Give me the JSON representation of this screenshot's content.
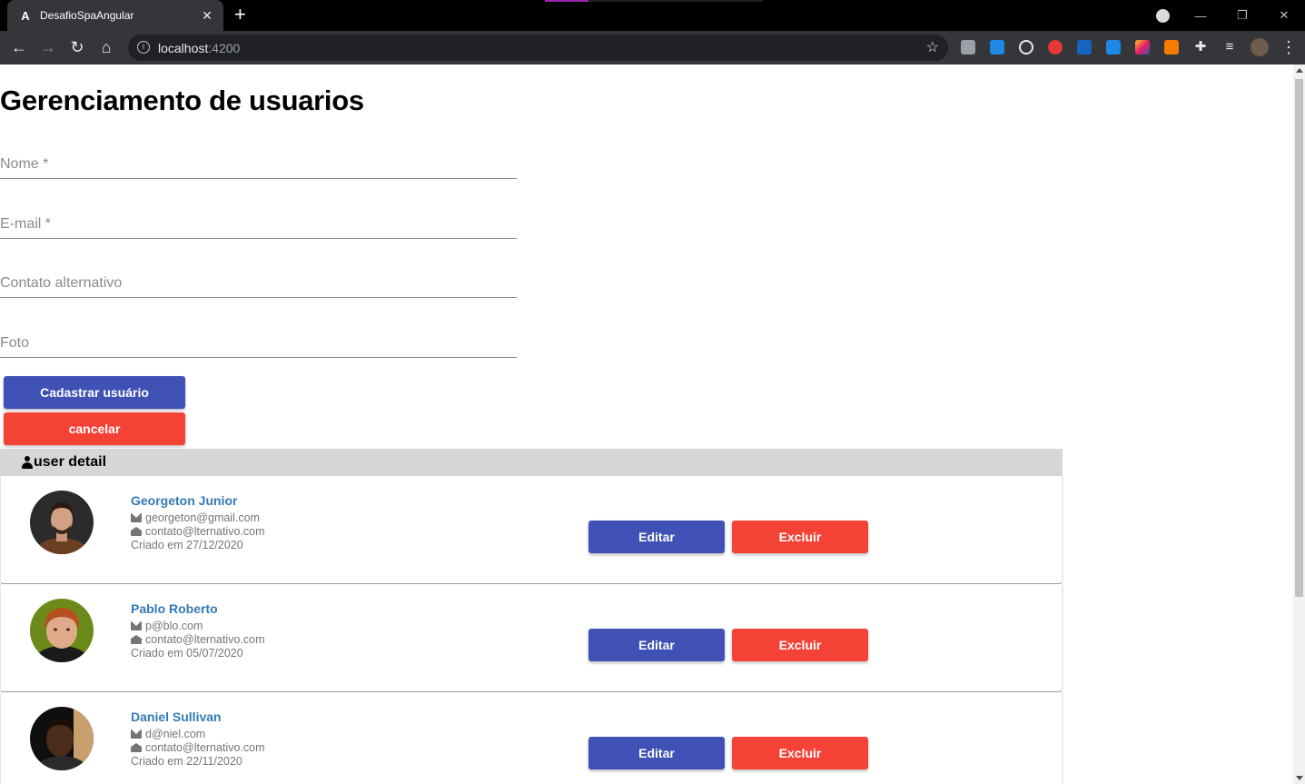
{
  "browser": {
    "tab_title": "DesafioSpaAngular",
    "tab_favicon": "A",
    "url_host": "localhost",
    "url_port": ":4200",
    "colors": {
      "tabbar": "#000000",
      "toolbar": "#35363a",
      "progress": "#9c27b0"
    }
  },
  "page": {
    "title": "Gerenciamento de usuarios",
    "form": {
      "name_placeholder": "Nome *",
      "email_placeholder": "E-mail *",
      "alt_contact_placeholder": "Contato alternativo",
      "photo_placeholder": "Foto",
      "submit_label": "Cadastrar usuário",
      "cancel_label": "cancelar"
    },
    "list": {
      "header": "user detail",
      "users": [
        {
          "name": "Georgeton Junior",
          "email": "georgeton@gmail.com",
          "alt_contact": "contato@lternativo.com",
          "created": "Criado em 27/12/2020",
          "edit_label": "Editar",
          "delete_label": "Excluir"
        },
        {
          "name": "Pablo Roberto",
          "email": "p@blo.com",
          "alt_contact": "contato@lternativo.com",
          "created": "Criado em 05/07/2020",
          "edit_label": "Editar",
          "delete_label": "Excluir"
        },
        {
          "name": "Daniel Sullivan",
          "email": "d@niel.com",
          "alt_contact": "contato@lternativo.com",
          "created": "Criado em 22/11/2020",
          "edit_label": "Editar",
          "delete_label": "Excluir"
        }
      ]
    },
    "colors": {
      "primary": "#3f51b5",
      "danger": "#f44336",
      "link": "#337ab7",
      "header_bg": "#d6d6d6"
    }
  }
}
